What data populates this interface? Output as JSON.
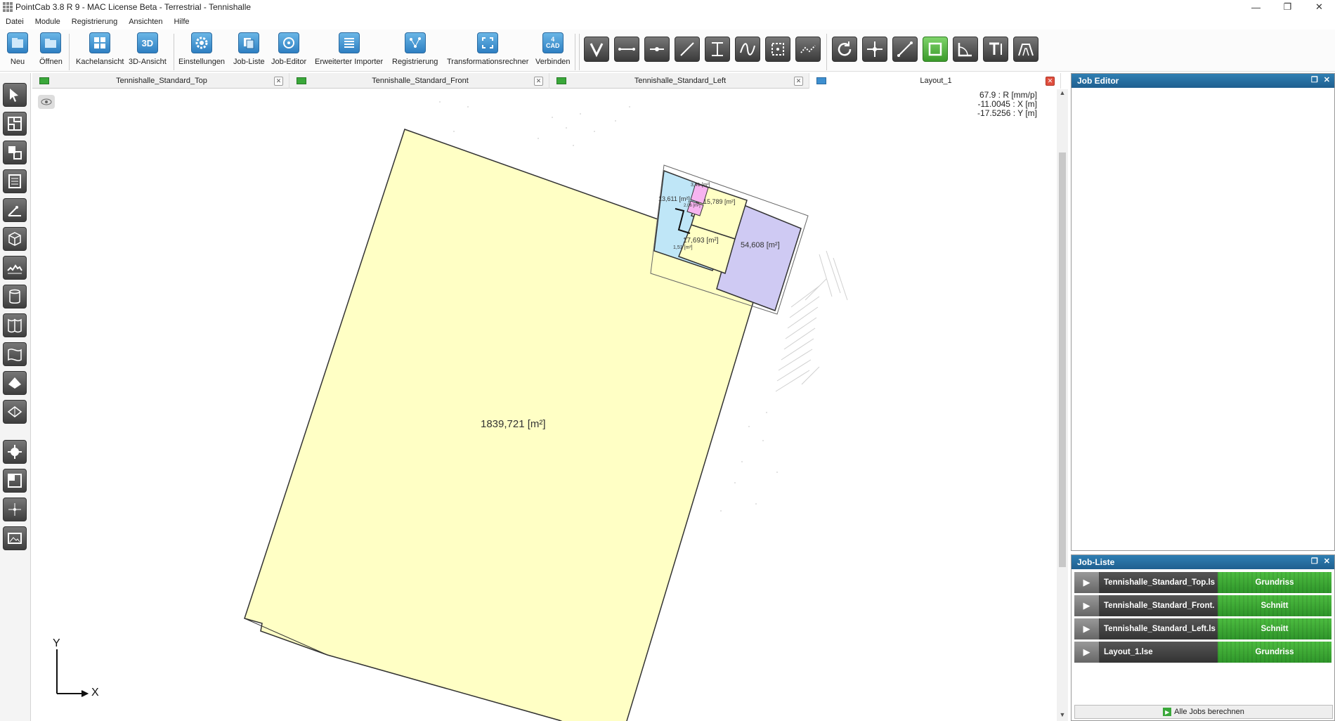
{
  "window": {
    "title": "PointCab 3.8 R 9 - MAC License Beta - Terrestrial - Tennishalle"
  },
  "menu": [
    "Datei",
    "Module",
    "Registrierung",
    "Ansichten",
    "Hilfe"
  ],
  "toolbar": {
    "neu": "Neu",
    "oeffnen": "Öffnen",
    "kachel": "Kachelansicht",
    "view3d": "3D-Ansicht",
    "view3d_icon_text": "3D",
    "einstellungen": "Einstellungen",
    "jobliste": "Job-Liste",
    "jobeditor": "Job-Editor",
    "importer": "Erweiterter Importer",
    "registrierung": "Registrierung",
    "transform": "Transformationsrechner",
    "verbinden": "Verbinden",
    "cad_icon_text_top": "4",
    "cad_icon_text_bottom": "CAD"
  },
  "tabs": [
    {
      "label": "Tennishalle_Standard_Top"
    },
    {
      "label": "Tennishalle_Standard_Front"
    },
    {
      "label": "Tennishalle_Standard_Left"
    },
    {
      "label": "Layout_1"
    }
  ],
  "coords": {
    "r": "67.9 : R [mm/p]",
    "x": "-11.0045 : X [m]",
    "y": "-17.5256 : Y [m]"
  },
  "plan": {
    "main_area": "1839,721 [m²]",
    "area_15": "15,789 [m²]",
    "area_17": "17,693 [m²]",
    "area_54": "54,608 [m²]",
    "area_13": "13,611 [m²]",
    "area_small1": "3,41 [m²]",
    "area_small2": "2,06 [m²]",
    "area_small3": "1,51 [m²]",
    "axis_x": "X",
    "axis_y": "Y"
  },
  "job_editor": {
    "title": "Job Editor"
  },
  "job_list": {
    "title": "Job-Liste",
    "jobs": [
      {
        "name": "Tennishalle_Standard_Top.ls",
        "type": "Grundriss"
      },
      {
        "name": "Tennishalle_Standard_Front.",
        "type": "Schnitt"
      },
      {
        "name": "Tennishalle_Standard_Left.ls",
        "type": "Schnitt"
      },
      {
        "name": "Layout_1.lse",
        "type": "Grundriss"
      }
    ],
    "run_all": "Alle Jobs berechnen"
  }
}
